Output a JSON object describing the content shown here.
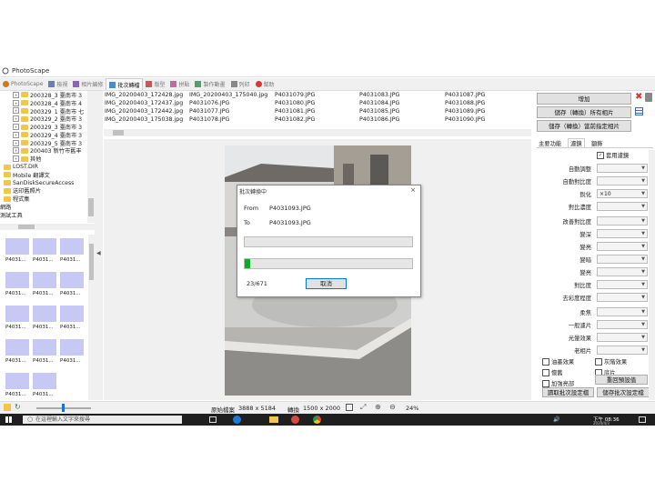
{
  "app": {
    "title": "PhotoScape"
  },
  "tabs": [
    {
      "label": "PhotoScape"
    },
    {
      "label": "檢視"
    },
    {
      "label": "相片編修"
    },
    {
      "label": "批次轉檔"
    },
    {
      "label": "版型"
    },
    {
      "label": "拼貼"
    },
    {
      "label": "製作動畫"
    },
    {
      "label": "列印"
    },
    {
      "label": "幫助"
    }
  ],
  "tree": [
    {
      "label": "200328_3 臺南市 3",
      "indent": 1
    },
    {
      "label": "200328_4 臺南市 4",
      "indent": 1
    },
    {
      "label": "200329_1 臺南市 七",
      "indent": 1
    },
    {
      "label": "200329_2 臺南市 3",
      "indent": 1
    },
    {
      "label": "200329_3 臺南市 3",
      "indent": 1
    },
    {
      "label": "200329_4 臺南市 3",
      "indent": 1
    },
    {
      "label": "200329_5 臺南市 3",
      "indent": 1
    },
    {
      "label": "200403 新竹市舊丰",
      "indent": 1
    },
    {
      "label": "其他",
      "indent": 1
    },
    {
      "label": "LOST.DIR",
      "indent": 0
    },
    {
      "label": "Mobile 翻譯文",
      "indent": 0
    },
    {
      "label": "SanDiskSecureAccess",
      "indent": 0
    },
    {
      "label": "送印舊照片",
      "indent": 0
    },
    {
      "label": "程式集",
      "indent": 0
    },
    {
      "label": "網路",
      "indent": -1
    },
    {
      "label": "測試工具",
      "indent": -1
    }
  ],
  "thumbs": [
    "P4031...",
    "P4031...",
    "P4031...",
    "P4031...",
    "P4031...",
    "P4031...",
    "P4031...",
    "P4031...",
    "P4031...",
    "P4031...",
    "P4031...",
    "P4031...",
    "P4031...",
    "P4031..."
  ],
  "files": [
    [
      "IMG_20200403_172428.jpg",
      "IMG_20200403_175040.jpg",
      "P4031079.JPG",
      "P4031083.JPG",
      "P4031087.JPG"
    ],
    [
      "IMG_20200403_172437.jpg",
      "P4031076.JPG",
      "P4031080.JPG",
      "P4031084.JPG",
      "P4031088.JPG"
    ],
    [
      "IMG_20200403_172442.jpg",
      "P4031077.JPG",
      "P4031081.JPG",
      "P4031085.JPG",
      "P4031089.JPG"
    ],
    [
      "IMG_20200403_175038.jpg",
      "P4031078.JPG",
      "P4031082.JPG",
      "P4031086.JPG",
      "P4031090.JPG"
    ]
  ],
  "dialog": {
    "title": "批次轉換中",
    "close": "×",
    "from_label": "From",
    "from_value": "P4031093.JPG",
    "to_label": "To",
    "to_value": "P4031093.JPG",
    "file_progress": 0.0,
    "total_progress": 0.034,
    "count": "23/671",
    "cancel": "取消"
  },
  "right": {
    "add": "增加",
    "save_all": "儲存（轉換）所有相片",
    "save_current": "儲存（轉換）當前指定相片",
    "tabs": [
      "主要功能",
      "濾鏡",
      "額飾"
    ],
    "enable_filter": "套用濾鏡",
    "filters": [
      {
        "label": "自動調整",
        "value": ""
      },
      {
        "label": "自動對比度",
        "value": ""
      },
      {
        "label": "銳化",
        "value": "×10"
      },
      {
        "label": "對比濃度",
        "value": ""
      },
      {
        "label": "改善對比度",
        "value": ""
      },
      {
        "label": "變深",
        "value": ""
      },
      {
        "label": "變亮",
        "value": ""
      },
      {
        "label": "變暗",
        "value": ""
      },
      {
        "label": "變亮",
        "value": ""
      },
      {
        "label": "對比度",
        "value": ""
      },
      {
        "label": "去彩度程度",
        "value": ""
      },
      {
        "label": "柔焦",
        "value": ""
      },
      {
        "label": "一般濾片",
        "value": ""
      },
      {
        "label": "光暈效果",
        "value": ""
      },
      {
        "label": "老相片",
        "value": ""
      }
    ],
    "checks": [
      {
        "label": "油墨效果",
        "col": 0,
        "row": 0
      },
      {
        "label": "灰階效果",
        "col": 1,
        "row": 0
      },
      {
        "label": "懷舊",
        "col": 0,
        "row": 1
      },
      {
        "label": "底片",
        "col": 1,
        "row": 1
      },
      {
        "label": "加強亮部",
        "col": 0,
        "row": 2
      }
    ],
    "reset": "重回預設值",
    "load_batch": "讀取批次設定檔",
    "save_batch": "儲存批次設定檔"
  },
  "status": {
    "original_label": "原始檔案",
    "original_size": "3888 x 5184",
    "converted_label": "轉換",
    "converted_size": "1500 x 2000",
    "zoom": "24%"
  },
  "taskbar": {
    "search_placeholder": "在這裡輸入文字來搜尋",
    "time": "下午 08:36",
    "date": "2020/4/3"
  }
}
